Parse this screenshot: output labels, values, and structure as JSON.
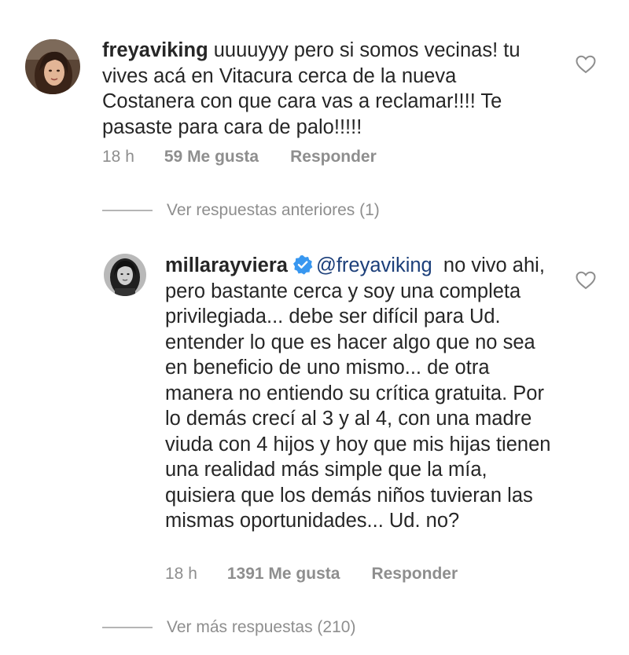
{
  "comments": [
    {
      "username": "freyaviking",
      "text": "uuuuyyy pero si somos vecinas! tu vives acá en Vitacura cerca de la nueva Costanera con que cara vas a reclamar!!!! Te pasaste para cara de palo!!!!!",
      "time": "18 h",
      "likes": "59 Me gusta",
      "reply_label": "Responder"
    },
    {
      "username": "millarayviera",
      "verified": true,
      "mention": "@freyaviking",
      "text": "no vivo ahi, pero bastante cerca y soy una completa privilegiada... debe ser difícil para Ud. entender lo que es hacer algo que no sea en beneficio de uno mismo... de otra manera no entiendo su crítica gratuita. Por lo demás crecí al 3 y al 4, con una madre viuda con 4 hijos y hoy que mis hijas tienen una realidad más simple que la mía, quisiera que los demás niños tuvieran las mismas oportunidades... Ud. no?",
      "time": "18 h",
      "likes": "1391 Me gusta",
      "reply_label": "Responder"
    }
  ],
  "thread": {
    "previous_replies": "Ver respuestas anteriores (1)",
    "more_replies": "Ver más respuestas (210)"
  },
  "colors": {
    "text": "#262626",
    "meta": "#8e8e8e",
    "mention": "#1c3f7a",
    "verified_badge": "#3897f0"
  },
  "icons": {
    "like": "heart-outline-icon",
    "verified": "verified-badge-icon"
  }
}
